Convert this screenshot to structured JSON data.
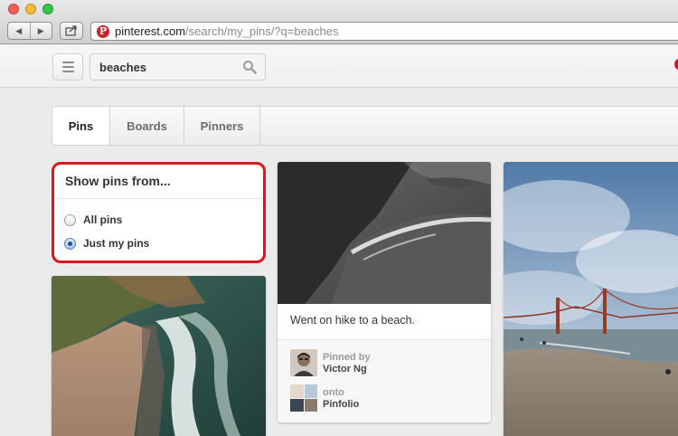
{
  "browser": {
    "url_host": "pinterest.com",
    "url_path": "/search/my_pins/?q=beaches",
    "back_glyph": "◀",
    "forward_glyph": "▶"
  },
  "header": {
    "search_value": "beaches"
  },
  "tabs": [
    {
      "label": "Pins",
      "selected": true
    },
    {
      "label": "Boards",
      "selected": false
    },
    {
      "label": "Pinners",
      "selected": false
    }
  ],
  "filter": {
    "title": "Show pins from...",
    "options": [
      {
        "label": "All pins",
        "checked": false
      },
      {
        "label": "Just my pins",
        "checked": true
      }
    ]
  },
  "pins": [
    {
      "description": "Went on hike to a beach.",
      "pinned_by_label": "Pinned by",
      "pinner_name": "Victor Ng",
      "onto_label": "onto",
      "board_name": "Pinfolio"
    }
  ],
  "colors": {
    "brand_red": "#cb2027",
    "highlight_red": "#e0141e"
  }
}
